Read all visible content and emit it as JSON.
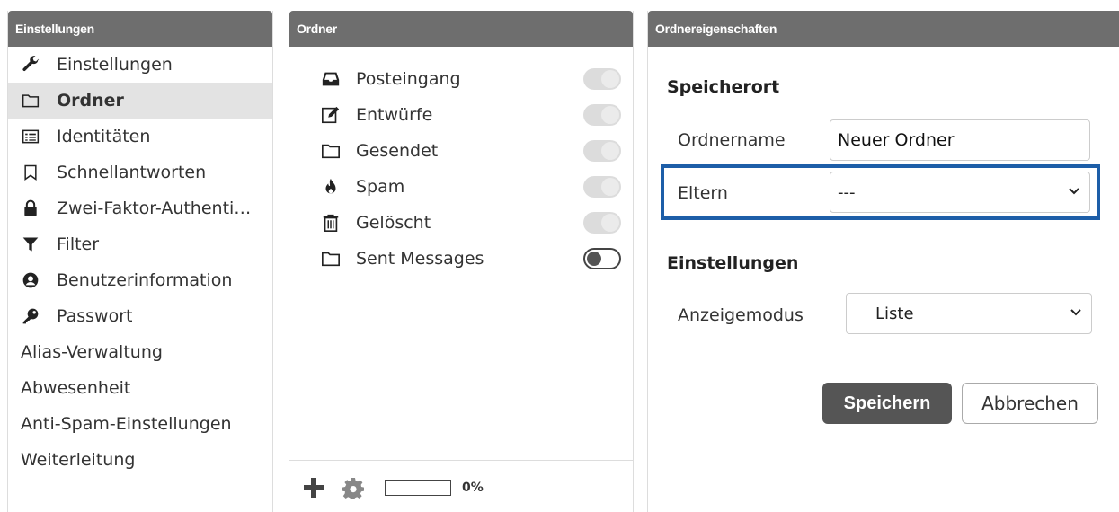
{
  "settings_panel": {
    "header": "Einstellungen",
    "items": [
      {
        "label": "Einstellungen",
        "icon": "wrench-icon"
      },
      {
        "label": "Ordner",
        "icon": "folder-icon",
        "selected": true
      },
      {
        "label": "Identitäten",
        "icon": "id-card-icon"
      },
      {
        "label": "Schnellantworten",
        "icon": "bookmark-icon"
      },
      {
        "label": "Zwei-Faktor-Authenti…",
        "icon": "lock-icon"
      },
      {
        "label": "Filter",
        "icon": "filter-icon"
      },
      {
        "label": "Benutzerinformation",
        "icon": "user-circle-icon"
      },
      {
        "label": "Passwort",
        "icon": "key-icon"
      },
      {
        "label": "Alias-Verwaltung"
      },
      {
        "label": "Abwesenheit"
      },
      {
        "label": "Anti-Spam-Einstellungen"
      },
      {
        "label": "Weiterleitung"
      }
    ]
  },
  "folders_panel": {
    "header": "Ordner",
    "items": [
      {
        "label": "Posteingang",
        "icon": "inbox-icon",
        "subscribed": true,
        "locked": true
      },
      {
        "label": "Entwürfe",
        "icon": "edit-icon",
        "subscribed": true,
        "locked": true
      },
      {
        "label": "Gesendet",
        "icon": "folder-icon",
        "subscribed": true,
        "locked": true
      },
      {
        "label": "Spam",
        "icon": "fire-icon",
        "subscribed": true,
        "locked": true
      },
      {
        "label": "Gelöscht",
        "icon": "trash-icon",
        "subscribed": true,
        "locked": true
      },
      {
        "label": "Sent Messages",
        "icon": "folder-icon",
        "subscribed": false,
        "locked": false
      }
    ],
    "quota_percent": 0,
    "quota_text": "0%"
  },
  "properties_panel": {
    "header": "Ordnereigenschaften",
    "location_section": "Speicherort",
    "name_label": "Ordnername",
    "name_value": "Neuer Ordner",
    "parent_label": "Eltern",
    "parent_value": "---",
    "settings_section": "Einstellungen",
    "view_mode_label": "Anzeigemodus",
    "view_mode_value": "Liste",
    "save_label": "Speichern",
    "cancel_label": "Abbrechen"
  },
  "colors": {
    "header_bg": "#6e6e6e",
    "selected_bg": "#e3e3e3",
    "highlight_border": "#1d5ea8",
    "primary_button": "#555555"
  }
}
